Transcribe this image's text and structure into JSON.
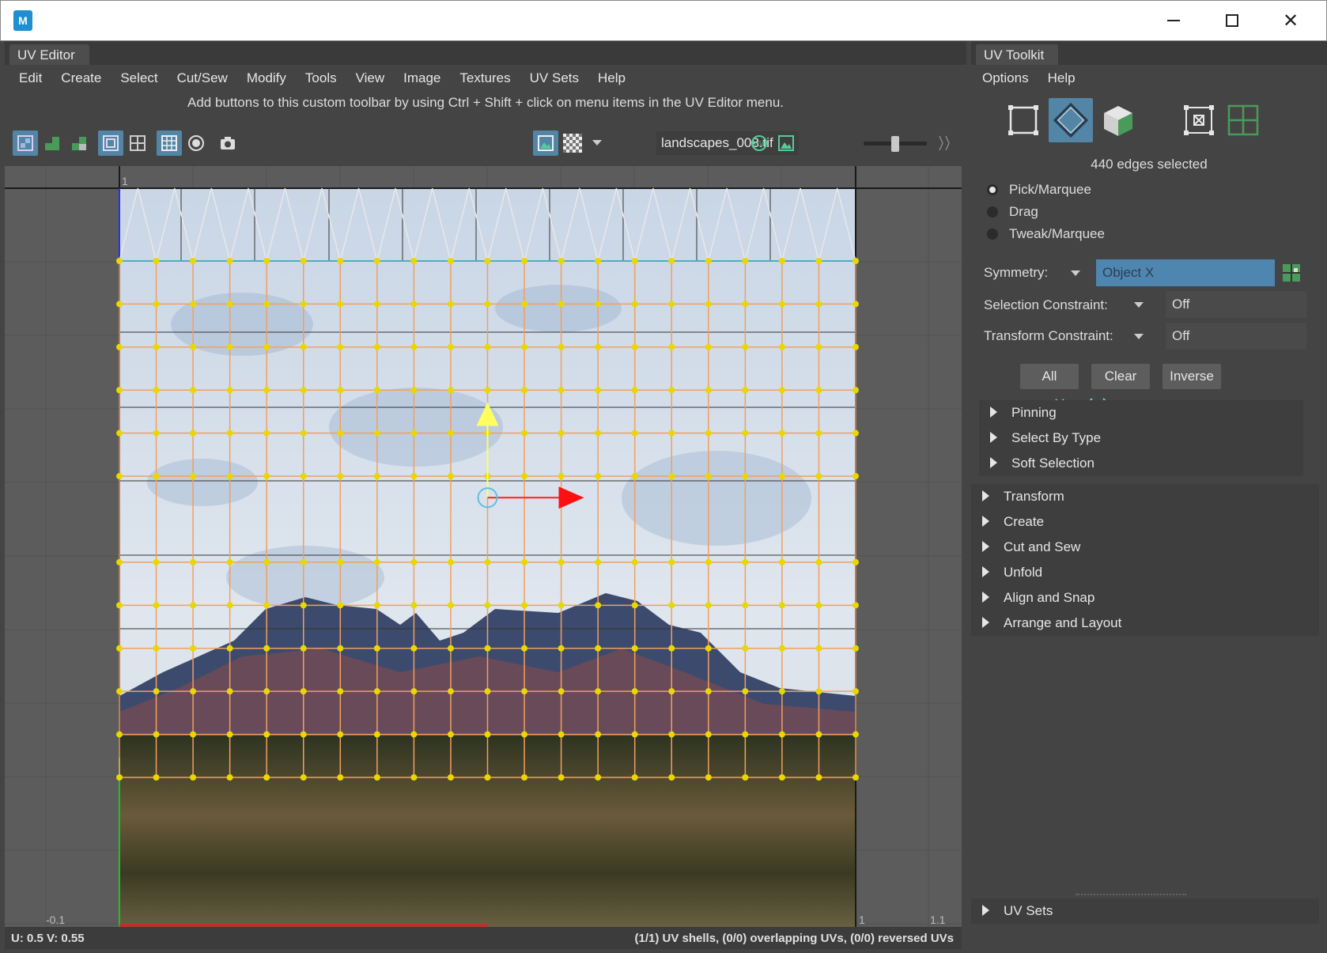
{
  "window": {
    "app_icon": "maya-icon",
    "minimize_icon": "minimize-icon",
    "maximize_icon": "maximize-icon",
    "close_icon": "close-icon",
    "close_glyph": "✕"
  },
  "uv_editor": {
    "tab_title": "UV Editor",
    "menu": [
      "Edit",
      "Create",
      "Select",
      "Cut/Sew",
      "Modify",
      "Tools",
      "View",
      "Image",
      "Textures",
      "UV Sets",
      "Help"
    ],
    "hint": "Add buttons to this custom toolbar by using Ctrl + Shift + click on menu items in the UV Editor menu.",
    "texture_name": "landscapes_008.tif",
    "exposure_slider": 0.5,
    "axis_labels": {
      "left": "-0.1",
      "top": "1",
      "bottom_right": "1",
      "right": "1.1"
    },
    "status": {
      "coords": "U:  0.5 V:  0.55",
      "stats": "(1/1) UV shells, (0/0) overlapping UVs, (0/0) reversed UVs"
    }
  },
  "uv_toolkit": {
    "tab_title": "UV Toolkit",
    "menu": [
      "Options",
      "Help"
    ],
    "selection_status": "440 edges selected",
    "tool_modes": [
      {
        "label": "Pick/Marquee",
        "selected": true
      },
      {
        "label": "Drag",
        "selected": false
      },
      {
        "label": "Tweak/Marquee",
        "selected": false
      }
    ],
    "symmetry": {
      "label": "Symmetry:",
      "value": "Object X"
    },
    "selection_constraint": {
      "label": "Selection Constraint:",
      "value": "Off"
    },
    "transform_constraint": {
      "label": "Transform Constraint:",
      "value": "Off"
    },
    "buttons": {
      "all": "All",
      "clear": "Clear",
      "inverse": "Inverse"
    },
    "subsections": [
      "Pinning",
      "Select By Type",
      "Soft Selection"
    ],
    "sections": [
      "Transform",
      "Create",
      "Cut and Sew",
      "Unfold",
      "Align and Snap",
      "Arrange and Layout"
    ],
    "footer_section": "UV Sets"
  },
  "colors": {
    "accent": "#5285a6",
    "uv_points": "#e8d800",
    "uv_edges": "#f0a060",
    "u_axis": "#ff0000",
    "v_axis": "#ffff60"
  }
}
